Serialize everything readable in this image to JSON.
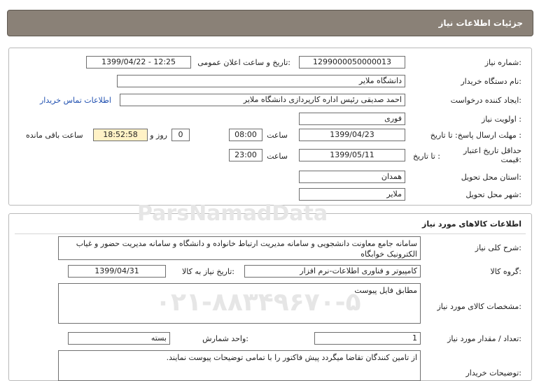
{
  "header": {
    "title": "جزئیات اطلاعات نیاز"
  },
  "info": {
    "need_number_label": "شماره نیاز:",
    "need_number": "1299000050000013",
    "announce_label": "تاریخ و ساعت اعلان عمومی:",
    "announce_value": "1399/04/22 - 12:25",
    "buyer_label": "نام دستگاه خریدار:",
    "buyer_value": "دانشگاه ملایر",
    "creator_label": "ایجاد کننده درخواست:",
    "creator_value": "احمد صدیقی رئیس اداره کارپردازی دانشگاه ملایر",
    "contact_link": "اطلاعات تماس خریدار",
    "priority_label": "اولویت نیاز :",
    "priority_value": "فوری",
    "deadline_label": "مهلت ارسال پاسخ:  تا تاریخ :",
    "deadline_date": "1399/04/23",
    "time_label": "ساعت",
    "deadline_time": "08:00",
    "days_value": "0",
    "days_label": "روز و",
    "remaining_time": "18:52:58",
    "remaining_label": "ساعت باقی مانده",
    "price_validity_label": "حداقل تاریخ اعتبار قیمت:",
    "until_date_label": "تا تاریخ :",
    "price_validity_date": "1399/05/11",
    "price_validity_time": "23:00",
    "province_label": "استان محل تحویل:",
    "province_value": "همدان",
    "city_label": "شهر محل تحویل:",
    "city_value": "ملایر"
  },
  "goods": {
    "section_title": "اطلاعات کالاهای مورد نیاز",
    "description_label": "شرح کلی نیاز:",
    "description_value": "سامانه جامع معاونت دانشجویی و سامانه مدیریت ارتباط خانواده و دانشگاه و سامانه مدیریت حضور و غیاب الکترونیک خوابگاه",
    "group_label": "گروه کالا:",
    "group_value": "کامپیوتر و فناوری اطلاعات-نرم افزار",
    "need_date_label": "تاریخ نیاز به کالا:",
    "need_date_value": "1399/04/31",
    "specs_label": "مشخصات کالای مورد نیاز:",
    "specs_value": "مطابق فایل پیوست",
    "quantity_label": "تعداد / مقدار مورد نیاز:",
    "quantity_value": "1",
    "unit_label": "واحد شمارش:",
    "unit_value": "بسته",
    "buyer_notes_label": "توضیحات خریدار:",
    "buyer_notes_value": "از تامین کنندگان تقاضا میگردد پیش فاکتور را با تمامی توضیحات پیوست نمایند."
  },
  "watermark": {
    "brand": "ParsNamadData",
    "phone": "۰۲۱-۸۸۳۴۹۶۷۰-۵"
  }
}
